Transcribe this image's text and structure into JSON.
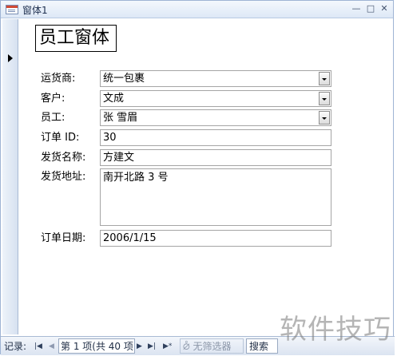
{
  "window": {
    "title": "窗体1"
  },
  "form": {
    "title": "员工窗体",
    "fields": {
      "shipper": {
        "label": "运货商:",
        "value": "统一包裹"
      },
      "customer": {
        "label": "客户:",
        "value": "文成"
      },
      "employee": {
        "label": "员工:",
        "value": "张 雪眉"
      },
      "order_id": {
        "label": "订单 ID:",
        "value": "30"
      },
      "ship_name": {
        "label": "发货名称:",
        "value": "方建文"
      },
      "ship_address": {
        "label": "发货地址:",
        "value": "南开北路 3 号"
      },
      "order_date": {
        "label": "订单日期:",
        "value": "2006/1/15"
      }
    }
  },
  "navbar": {
    "record_label": "记录:",
    "position_text": "第 1 项(共 40 项",
    "filter_label": "无筛选器",
    "search_label": "搜索"
  },
  "watermark": "软件技巧"
}
